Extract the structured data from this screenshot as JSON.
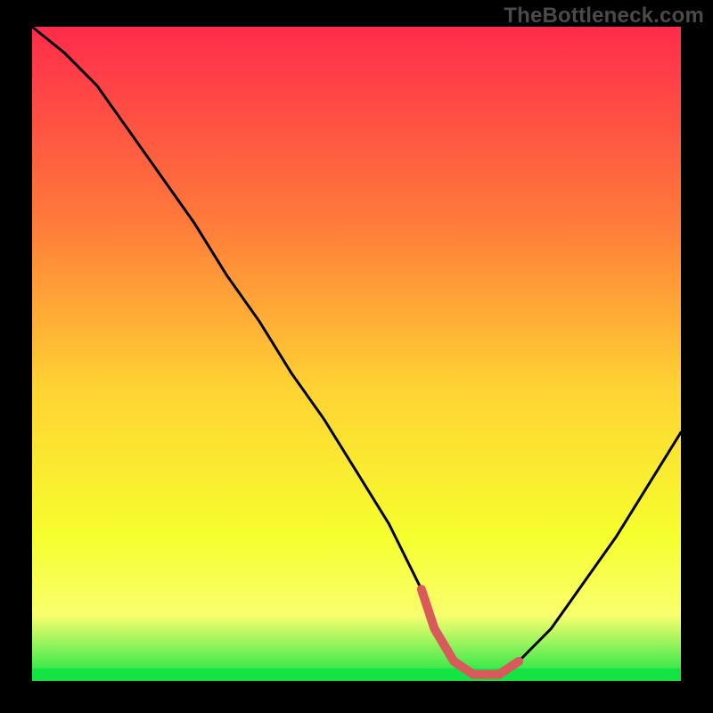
{
  "attribution": "TheBottleneck.com",
  "colors": {
    "frame": "#000000",
    "gradient_top": "#ff2b4b",
    "gradient_mid_upper": "#ff7b3a",
    "gradient_mid": "#ffd233",
    "gradient_mid_lower": "#f6ff2e",
    "gradient_yellow_band": "#f8ff6e",
    "gradient_green": "#13e444",
    "curve_stroke": "#000000",
    "valley_highlight": "#d85a5a"
  },
  "chart_data": {
    "type": "line",
    "title": "",
    "xlabel": "",
    "ylabel": "",
    "xlim": [
      0,
      100
    ],
    "ylim": [
      0,
      100
    ],
    "x": [
      0,
      5,
      10,
      15,
      20,
      25,
      30,
      35,
      40,
      45,
      50,
      55,
      60,
      62,
      65,
      68,
      70,
      72,
      75,
      80,
      85,
      90,
      95,
      100
    ],
    "values": [
      100,
      96,
      91,
      84,
      77,
      70,
      62,
      55,
      47,
      40,
      32,
      24,
      14,
      8,
      3,
      1,
      1,
      1,
      3,
      8,
      15,
      22,
      30,
      38
    ],
    "valley_flat_range_x": [
      62,
      75
    ],
    "description": "Bottleneck curve: steep descent from top-left to a flat minimum near x≈62–75, then a shallower rise toward the right edge."
  }
}
